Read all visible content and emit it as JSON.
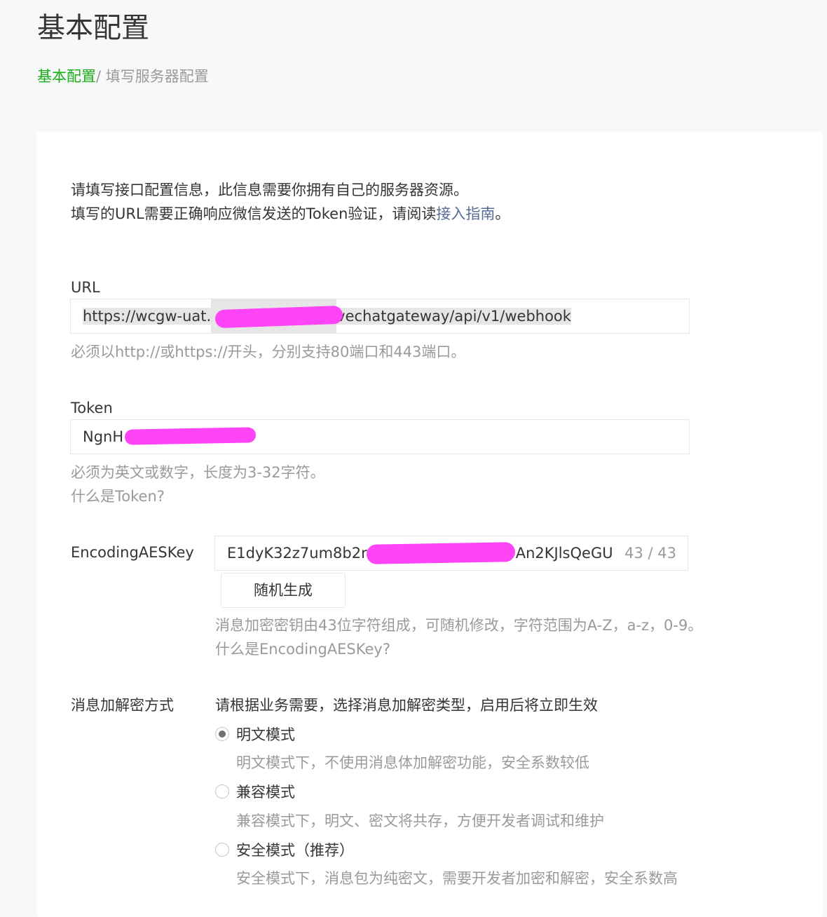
{
  "header": {
    "title": "基本配置",
    "breadcrumb": {
      "parent": "基本配置",
      "separator": "/ ",
      "current": "填写服务器配置"
    }
  },
  "intro": {
    "line1": "请填写接口配置信息，此信息需要你拥有自己的服务器资源。",
    "line2_prefix": "填写的URL需要正确响应微信发送的Token验证，请阅读",
    "line2_link": "接入指南",
    "line2_suffix": "。"
  },
  "url_field": {
    "label": "URL",
    "value_start": "https://wcgw-uat.",
    "value_end": "vechatgateway/api/v1/webhook",
    "hint": "必须以http://或https://开头，分别支持80端口和443端口。"
  },
  "token_field": {
    "label": "Token",
    "value_start": "NgnH",
    "hint": "必须为英文或数字，长度为3-32字符。",
    "help_link": "什么是Token?"
  },
  "aes_field": {
    "label": "EncodingAESKey",
    "value_start": "E1dyK32z7um8b2r",
    "value_end": "An2KJlsQeGU",
    "counter": "43 / 43",
    "generate_button": "随机生成",
    "hint": "消息加密密钥由43位字符组成，可随机修改，字符范围为A-Z，a-z，0-9。",
    "help_link": "什么是EncodingAESKey?"
  },
  "encryption": {
    "label": "消息加解密方式",
    "description": "请根据业务需要，选择消息加解密类型，启用后将立即生效",
    "options": [
      {
        "label": "明文模式",
        "desc": "明文模式下，不使用消息体加解密功能，安全系数较低",
        "checked": true
      },
      {
        "label": "兼容模式",
        "desc": "兼容模式下，明文、密文将共存，方便开发者调试和维护",
        "checked": false
      },
      {
        "label": "安全模式（推荐）",
        "desc": "安全模式下，消息包为纯密文，需要开发者加密和解密，安全系数高",
        "checked": false
      }
    ]
  },
  "colors": {
    "accent_green": "#1aad19",
    "link_blue": "#576b95",
    "redaction": "#ff44f7"
  }
}
